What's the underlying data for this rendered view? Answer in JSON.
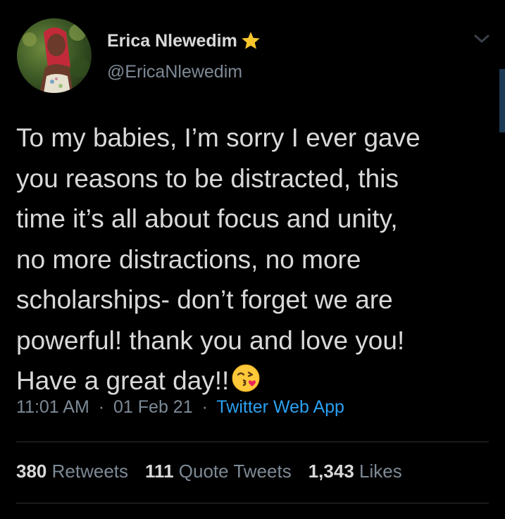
{
  "author": {
    "display_name": "Erica Nlewedim",
    "handle": "@EricaNlewedim",
    "verified_badge_icon": "star-icon"
  },
  "tweet": {
    "text": "To my babies, I’m sorry I ever gave\nyou reasons to be distracted, this\ntime it’s all about focus and unity,\nno more distractions, no more\nscholarships- don’t forget we are\npowerful! thank you and love you!\nHave a great day!!",
    "emoji_icon": "face-blowing-kiss-icon",
    "time": "11:01 AM",
    "date": "01 Feb 21",
    "separator": "·",
    "source": "Twitter Web App"
  },
  "stats": {
    "retweets_count": "380",
    "retweets_label": "Retweets",
    "quote_tweets_count": "111",
    "quote_tweets_label": "Quote Tweets",
    "likes_count": "1,343",
    "likes_label": "Likes"
  },
  "colors": {
    "background": "#000000",
    "text_primary": "#d9d9d9",
    "text_secondary": "#7d8a96",
    "link": "#2aa0f0",
    "star": "#f7c62c"
  }
}
